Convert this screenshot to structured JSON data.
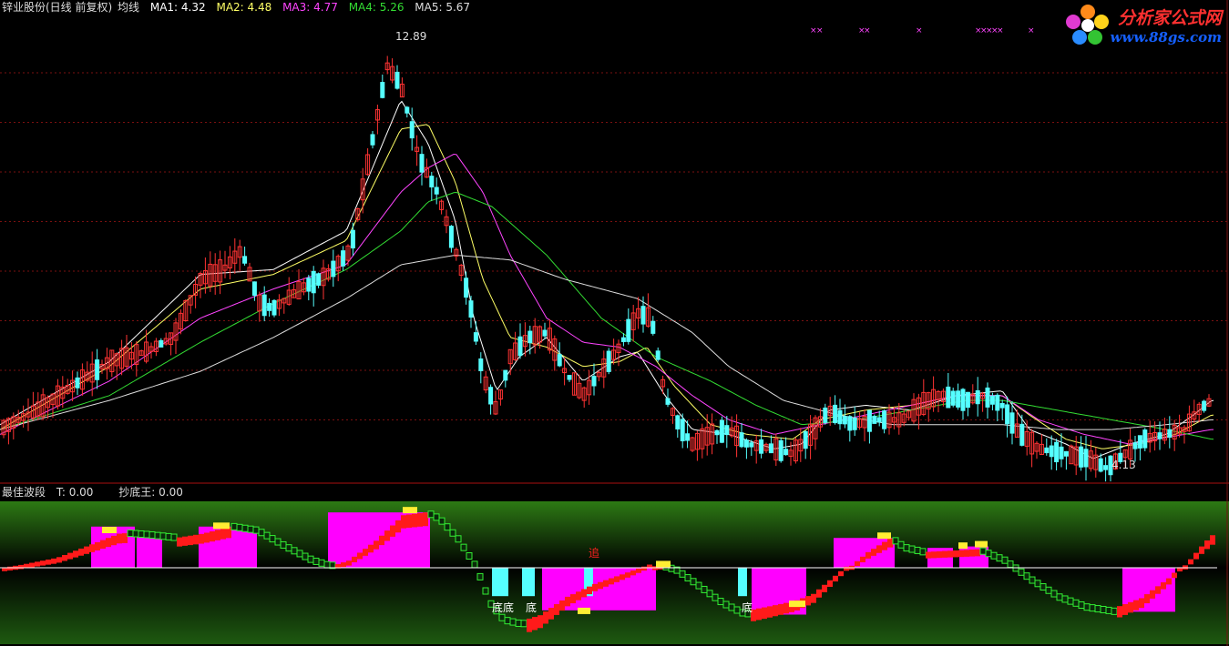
{
  "header": {
    "stock_name": "锌业股份(日线 前复权)",
    "indicator": "均线",
    "ma": [
      {
        "label": "MA1: 4.32",
        "color": "#ffffff"
      },
      {
        "label": "MA2: 4.48",
        "color": "#ffff66"
      },
      {
        "label": "MA3: 4.77",
        "color": "#ff44ff"
      },
      {
        "label": "MA4: 5.26",
        "color": "#33dd33"
      },
      {
        "label": "MA5: 5.67",
        "color": "#dddddd"
      }
    ]
  },
  "sub_header": {
    "name": "最佳波段",
    "t_label": "T: 0.00",
    "cdw_label": "抄底王: 0.00"
  },
  "watermark": {
    "title": "分析家公式网",
    "url": "www.88gs.com"
  },
  "annotations": {
    "high": "12.89",
    "low": "4.13",
    "chase": "追",
    "bottom": "底"
  },
  "chart_data": {
    "type": "candlestick",
    "price_range": [
      4.0,
      13.2
    ],
    "high_label": 12.89,
    "low_label": 4.13,
    "colors": {
      "up": "#ff3333",
      "down": "#55ffff",
      "bg": "#000000",
      "grid": "#7a1010"
    },
    "ma_keys": [
      {
        "pts": [
          [
            0,
            5.0
          ],
          [
            120,
            6.3
          ],
          [
            220,
            8.1
          ],
          [
            300,
            8.2
          ],
          [
            380,
            9.0
          ],
          [
            440,
            11.7
          ],
          [
            470,
            10.8
          ],
          [
            500,
            9.2
          ],
          [
            520,
            7.2
          ],
          [
            545,
            5.7
          ],
          [
            570,
            6.4
          ],
          [
            600,
            6.8
          ],
          [
            640,
            5.9
          ],
          [
            680,
            6.4
          ],
          [
            700,
            6.5
          ],
          [
            730,
            5.6
          ],
          [
            760,
            4.9
          ],
          [
            800,
            4.8
          ],
          [
            850,
            4.5
          ],
          [
            880,
            4.6
          ],
          [
            910,
            5.3
          ],
          [
            950,
            5.4
          ],
          [
            1000,
            5.3
          ],
          [
            1050,
            5.6
          ],
          [
            1100,
            5.7
          ],
          [
            1130,
            4.9
          ],
          [
            1170,
            4.6
          ],
          [
            1200,
            4.3
          ],
          [
            1240,
            4.6
          ],
          [
            1280,
            4.8
          ],
          [
            1310,
            5.2
          ],
          [
            1330,
            5.5
          ]
        ]
      },
      {
        "pts": [
          [
            0,
            4.9
          ],
          [
            120,
            6.2
          ],
          [
            220,
            7.8
          ],
          [
            300,
            8.1
          ],
          [
            380,
            8.8
          ],
          [
            440,
            11.1
          ],
          [
            470,
            11.2
          ],
          [
            500,
            10.0
          ],
          [
            530,
            8.0
          ],
          [
            560,
            6.8
          ],
          [
            600,
            6.6
          ],
          [
            640,
            6.2
          ],
          [
            680,
            6.3
          ],
          [
            710,
            6.6
          ],
          [
            740,
            5.8
          ],
          [
            780,
            5.0
          ],
          [
            820,
            4.8
          ],
          [
            870,
            4.7
          ],
          [
            900,
            5.1
          ],
          [
            950,
            5.3
          ],
          [
            1000,
            5.4
          ],
          [
            1050,
            5.6
          ],
          [
            1100,
            5.6
          ],
          [
            1130,
            5.2
          ],
          [
            1170,
            4.7
          ],
          [
            1210,
            4.5
          ],
          [
            1250,
            4.6
          ],
          [
            1290,
            4.8
          ],
          [
            1330,
            5.2
          ]
        ]
      },
      {
        "pts": [
          [
            0,
            4.8
          ],
          [
            120,
            5.9
          ],
          [
            220,
            7.2
          ],
          [
            300,
            7.8
          ],
          [
            380,
            8.3
          ],
          [
            440,
            9.8
          ],
          [
            470,
            10.3
          ],
          [
            500,
            10.6
          ],
          [
            530,
            9.8
          ],
          [
            560,
            8.5
          ],
          [
            600,
            7.2
          ],
          [
            640,
            6.7
          ],
          [
            680,
            6.6
          ],
          [
            720,
            6.2
          ],
          [
            760,
            5.6
          ],
          [
            800,
            5.1
          ],
          [
            850,
            4.8
          ],
          [
            900,
            5.0
          ],
          [
            950,
            5.2
          ],
          [
            1000,
            5.4
          ],
          [
            1050,
            5.6
          ],
          [
            1100,
            5.6
          ],
          [
            1140,
            5.1
          ],
          [
            1190,
            4.8
          ],
          [
            1240,
            4.6
          ],
          [
            1300,
            4.8
          ],
          [
            1330,
            4.9
          ]
        ]
      },
      {
        "pts": [
          [
            0,
            4.9
          ],
          [
            120,
            5.6
          ],
          [
            220,
            6.7
          ],
          [
            300,
            7.5
          ],
          [
            380,
            8.2
          ],
          [
            440,
            9.0
          ],
          [
            470,
            9.6
          ],
          [
            500,
            9.8
          ],
          [
            540,
            9.5
          ],
          [
            600,
            8.5
          ],
          [
            660,
            7.2
          ],
          [
            720,
            6.4
          ],
          [
            780,
            5.9
          ],
          [
            830,
            5.4
          ],
          [
            880,
            5.0
          ],
          [
            940,
            5.1
          ],
          [
            1000,
            5.3
          ],
          [
            1060,
            5.5
          ],
          [
            1100,
            5.5
          ],
          [
            1160,
            5.3
          ],
          [
            1220,
            5.1
          ],
          [
            1280,
            4.9
          ],
          [
            1330,
            4.7
          ]
        ]
      },
      {
        "pts": [
          [
            0,
            4.9
          ],
          [
            120,
            5.5
          ],
          [
            220,
            6.1
          ],
          [
            300,
            6.8
          ],
          [
            380,
            7.6
          ],
          [
            440,
            8.3
          ],
          [
            500,
            8.5
          ],
          [
            560,
            8.4
          ],
          [
            620,
            8.0
          ],
          [
            700,
            7.6
          ],
          [
            760,
            6.9
          ],
          [
            800,
            6.2
          ],
          [
            860,
            5.5
          ],
          [
            920,
            5.2
          ],
          [
            980,
            5.0
          ],
          [
            1040,
            5.0
          ],
          [
            1100,
            5.0
          ],
          [
            1160,
            4.9
          ],
          [
            1220,
            4.9
          ],
          [
            1280,
            5.0
          ],
          [
            1330,
            5.1
          ]
        ]
      }
    ],
    "price_keys": [
      [
        0,
        4.9
      ],
      [
        40,
        5.3
      ],
      [
        80,
        5.8
      ],
      [
        120,
        6.3
      ],
      [
        160,
        6.5
      ],
      [
        190,
        6.8
      ],
      [
        220,
        8.0
      ],
      [
        245,
        8.2
      ],
      [
        265,
        8.6
      ],
      [
        285,
        7.5
      ],
      [
        300,
        7.4
      ],
      [
        330,
        7.8
      ],
      [
        360,
        8.1
      ],
      [
        385,
        8.6
      ],
      [
        405,
        10.5
      ],
      [
        425,
        12.4
      ],
      [
        440,
        12.0
      ],
      [
        460,
        10.5
      ],
      [
        480,
        9.8
      ],
      [
        500,
        8.6
      ],
      [
        515,
        7.6
      ],
      [
        530,
        6.0
      ],
      [
        545,
        5.3
      ],
      [
        560,
        6.4
      ],
      [
        580,
        6.8
      ],
      [
        600,
        6.9
      ],
      [
        620,
        6.1
      ],
      [
        640,
        5.6
      ],
      [
        660,
        6.1
      ],
      [
        680,
        6.6
      ],
      [
        700,
        7.3
      ],
      [
        715,
        7.2
      ],
      [
        730,
        5.6
      ],
      [
        745,
        5.0
      ],
      [
        760,
        4.6
      ],
      [
        780,
        4.8
      ],
      [
        800,
        4.9
      ],
      [
        820,
        4.6
      ],
      [
        850,
        4.5
      ],
      [
        870,
        4.4
      ],
      [
        890,
        4.8
      ],
      [
        910,
        5.3
      ],
      [
        935,
        5.0
      ],
      [
        960,
        5.1
      ],
      [
        990,
        5.1
      ],
      [
        1010,
        5.4
      ],
      [
        1030,
        5.6
      ],
      [
        1060,
        5.5
      ],
      [
        1080,
        5.6
      ],
      [
        1100,
        5.4
      ],
      [
        1115,
        4.9
      ],
      [
        1140,
        4.5
      ],
      [
        1170,
        4.4
      ],
      [
        1195,
        4.3
      ],
      [
        1215,
        4.1
      ],
      [
        1235,
        4.4
      ],
      [
        1255,
        4.7
      ],
      [
        1280,
        4.8
      ],
      [
        1300,
        4.9
      ],
      [
        1315,
        5.3
      ],
      [
        1330,
        5.5
      ]
    ],
    "sell_marks_x": [
      889,
      896,
      942,
      948,
      1005,
      1070,
      1076,
      1082,
      1088,
      1094,
      1128
    ],
    "oscillator": {
      "range": [
        -100,
        100
      ],
      "colors": {
        "green_up": "#33ee33",
        "green_down": "#0a2a0a",
        "fill_pos_top": "#2d7a14",
        "fill_neg_bottom": "#1e5a10",
        "red": "#ff1a1a",
        "magenta": "#ff00ff",
        "yellow": "#ffee33",
        "cyan": "#55ffff"
      },
      "wave": [
        [
          0,
          0
        ],
        [
          20,
          4
        ],
        [
          60,
          14
        ],
        [
          100,
          34
        ],
        [
          130,
          49
        ],
        [
          160,
          46
        ],
        [
          190,
          42
        ],
        [
          220,
          48
        ],
        [
          250,
          58
        ],
        [
          280,
          52
        ],
        [
          310,
          30
        ],
        [
          340,
          10
        ],
        [
          360,
          2
        ],
        [
          380,
          10
        ],
        [
          410,
          38
        ],
        [
          440,
          74
        ],
        [
          465,
          78
        ],
        [
          480,
          68
        ],
        [
          500,
          40
        ],
        [
          520,
          0
        ],
        [
          535,
          -50
        ],
        [
          550,
          -74
        ],
        [
          570,
          -80
        ],
        [
          590,
          -72
        ],
        [
          620,
          -46
        ],
        [
          650,
          -28
        ],
        [
          690,
          -10
        ],
        [
          720,
          4
        ],
        [
          740,
          -4
        ],
        [
          760,
          -22
        ],
        [
          790,
          -50
        ],
        [
          815,
          -66
        ],
        [
          840,
          -60
        ],
        [
          870,
          -52
        ],
        [
          890,
          -42
        ],
        [
          920,
          -10
        ],
        [
          950,
          22
        ],
        [
          975,
          42
        ],
        [
          990,
          28
        ],
        [
          1010,
          22
        ],
        [
          1040,
          24
        ],
        [
          1070,
          26
        ],
        [
          1100,
          10
        ],
        [
          1130,
          -18
        ],
        [
          1160,
          -42
        ],
        [
          1190,
          -56
        ],
        [
          1220,
          -62
        ],
        [
          1250,
          -48
        ],
        [
          1280,
          -20
        ],
        [
          1300,
          6
        ],
        [
          1320,
          36
        ],
        [
          1333,
          52
        ]
      ],
      "pink_blocks": [
        [
          100,
          148,
          58
        ],
        [
          150,
          178,
          48
        ],
        [
          218,
          282,
          58
        ],
        [
          360,
          472,
          78
        ],
        [
          595,
          720,
          -60
        ],
        [
          825,
          885,
          -66
        ],
        [
          915,
          982,
          42
        ],
        [
          1018,
          1046,
          28
        ],
        [
          1053,
          1085,
          30
        ],
        [
          1232,
          1290,
          -62
        ]
      ],
      "cyan_blocks": [
        [
          540,
          558,
          -40
        ],
        [
          573,
          587,
          -40
        ],
        [
          641,
          651,
          -40
        ],
        [
          810,
          820,
          -40
        ]
      ],
      "yellow_blocks": [
        [
          112,
          128,
          50
        ],
        [
          234,
          252,
          56
        ],
        [
          442,
          458,
          78
        ],
        [
          634,
          648,
          -64
        ],
        [
          720,
          736,
          2
        ],
        [
          866,
          884,
          -54
        ],
        [
          963,
          978,
          42
        ],
        [
          1052,
          1062,
          28
        ],
        [
          1070,
          1084,
          30
        ]
      ]
    }
  }
}
